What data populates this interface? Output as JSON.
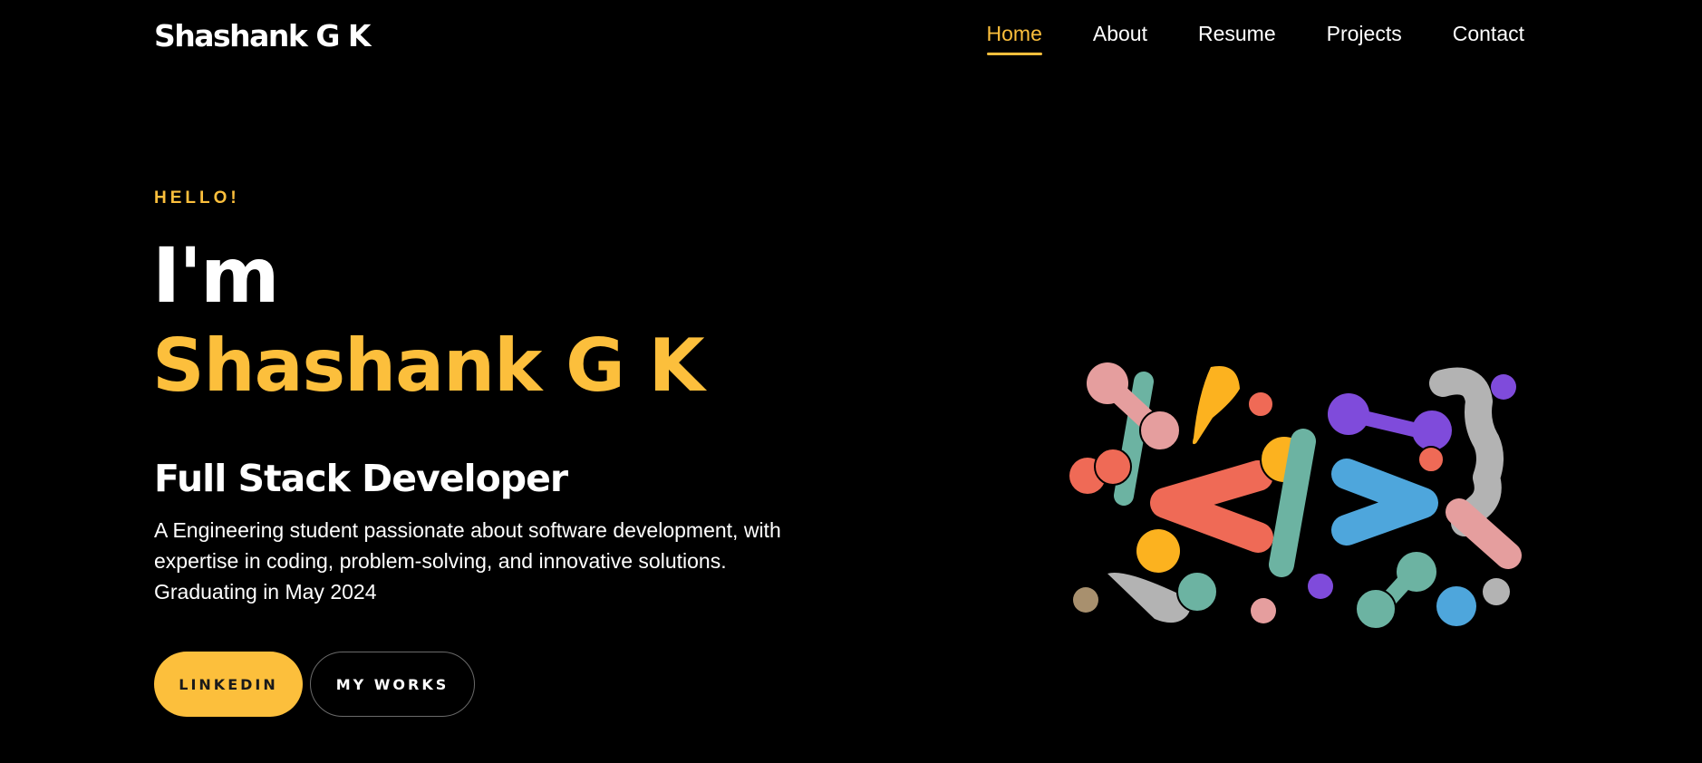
{
  "header": {
    "logo": "Shashank G K",
    "nav": [
      {
        "label": "Home",
        "active": true
      },
      {
        "label": "About",
        "active": false
      },
      {
        "label": "Resume",
        "active": false
      },
      {
        "label": "Projects",
        "active": false
      },
      {
        "label": "Contact",
        "active": false
      }
    ]
  },
  "hero": {
    "greeting": "HELLO!",
    "intro": "I'm",
    "name": "Shashank G K",
    "role": "Full Stack Developer",
    "description": "A Engineering student passionate about software development, with expertise in coding, problem-solving, and innovative solutions. Graduating in May 2024",
    "buttons": {
      "linkedin": "LINKEDIN",
      "works": "MY WORKS"
    }
  },
  "illustration": {
    "icon": "code-tag-icon",
    "colors": {
      "orange": "#ef6a56",
      "blue": "#4ea6dc",
      "green": "#6cb3a2",
      "yellow": "#fcb21f",
      "purple": "#7f4bdb",
      "pink": "#e59e9e",
      "gray": "#b3b3b3",
      "tan": "#a8906e"
    }
  },
  "theme": {
    "accent": "#fcbf3c",
    "background": "#000000",
    "text": "#ffffff"
  }
}
